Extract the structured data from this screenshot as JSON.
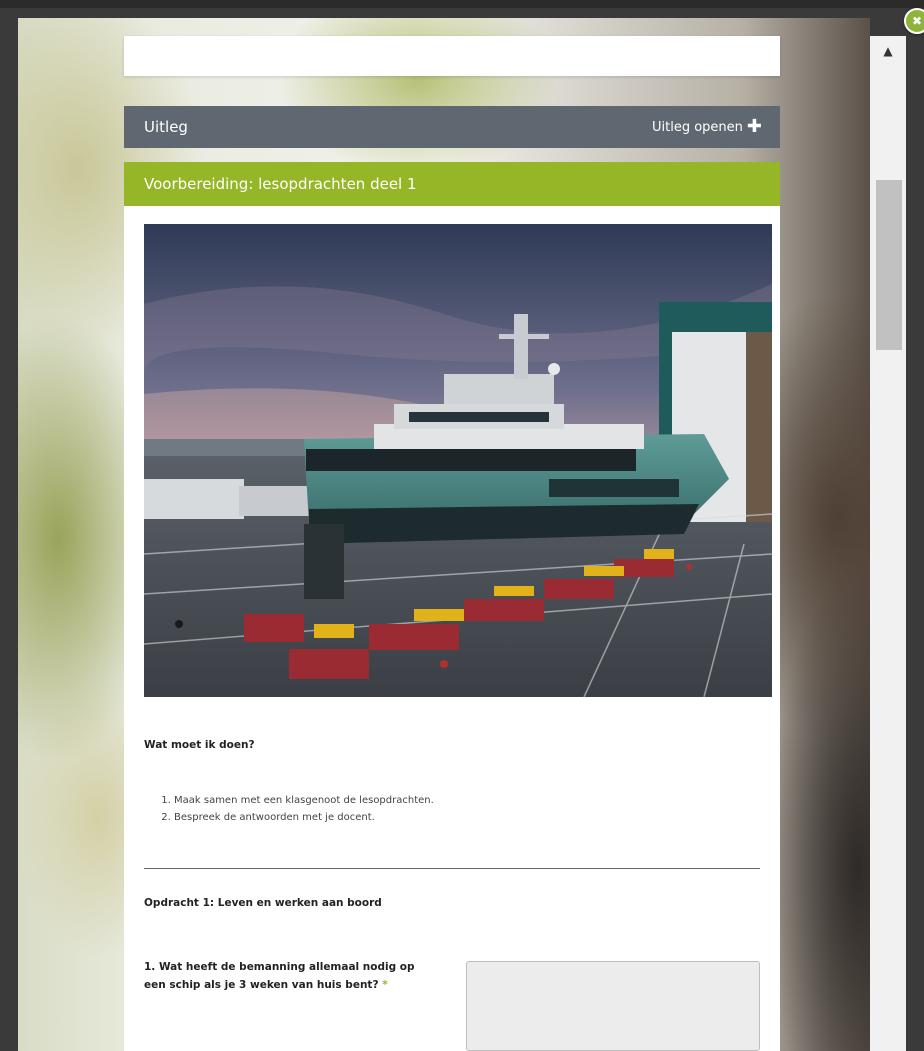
{
  "modal": {
    "close_icon": "close-icon"
  },
  "uitleg": {
    "title": "Uitleg",
    "toggle_label": "Uitleg openen",
    "toggle_icon": "plus-icon"
  },
  "section": {
    "title": "Voorbereiding: lesopdrachten deel 1"
  },
  "content": {
    "question_heading": "Wat moet ik doen?",
    "steps": [
      "Maak samen met een klasgenoot de lesopdrachten.",
      "Bespreek de antwoorden met je docent."
    ],
    "assignment_title": "Opdracht 1: Leven en werken aan boord",
    "question1": {
      "label": "1. Wat heeft de bemanning allemaal nodig op een schip als je 3 weken van huis bent?",
      "required_mark": "*",
      "answer": ""
    }
  },
  "colors": {
    "uitleg_bar": "#5f6771",
    "section_header": "#95b626",
    "accent": "#8fb43a"
  }
}
